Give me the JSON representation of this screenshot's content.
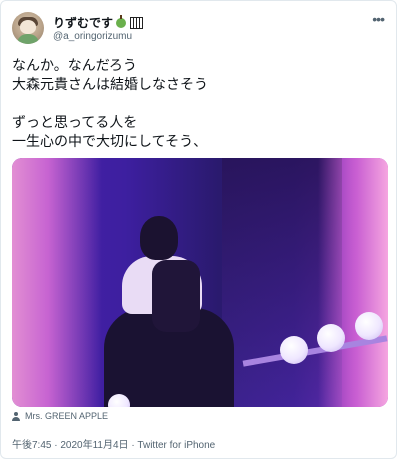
{
  "tweet": {
    "display_name": "りずむです",
    "handle": "@a_oringorizumu",
    "text": "なんか。なんだろう\n大森元貴さんは結婚しなさそう\n\nずっと思ってる人を\n一生心の中で大切にしてそう、",
    "media_tag": "Mrs. GREEN APPLE",
    "meta": "午後7:45 · 2020年11月4日 · Twitter for iPhone"
  },
  "icons": {
    "avatar": "user-avatar",
    "name_emoji_1": "green-apple-icon",
    "name_emoji_2": "piano-keys-icon",
    "more": "more-dots-icon",
    "tag": "person-tag-icon"
  },
  "colors": {
    "text_primary": "#0f1419",
    "text_secondary": "#536471",
    "border": "#e1e8ed"
  }
}
